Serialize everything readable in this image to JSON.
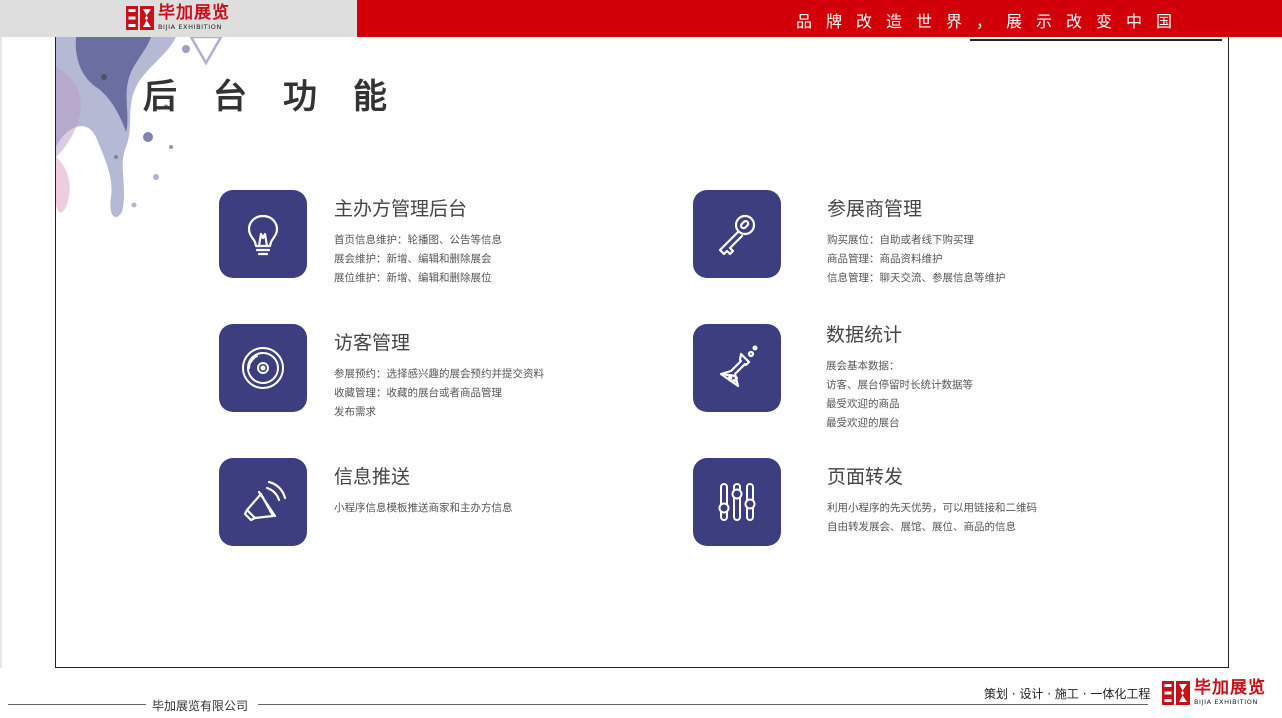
{
  "header": {
    "brand_cn": "毕加展览",
    "brand_en": "BIJIA EXHIBITION",
    "slogan": "品牌改造世界，展示改变中国",
    "colors": {
      "bar_red": "#d10009",
      "bar_gray": "#dedede",
      "logo_red": "#c8101a"
    }
  },
  "page": {
    "title": "后台功能",
    "tile_color": "#3c3e7f"
  },
  "features": [
    {
      "icon": "lightbulb-icon",
      "title": "主办方管理后台",
      "lines": [
        "首页信息维护：轮播图、公告等信息",
        "展会维护：新增、编辑和删除展会",
        "展位维护：新增、编辑和删除展位"
      ]
    },
    {
      "icon": "key-icon",
      "title": "参展商管理",
      "lines": [
        "购买展位：自助或者线下购买理",
        "商品管理：商品资料维护",
        "信息管理：聊天交流、参展信息等维护"
      ]
    },
    {
      "icon": "vinyl-disc-icon",
      "title": "访客管理",
      "lines": [
        "参展预约：选择感兴趣的展会预约并提交资料",
        "收藏管理：收藏的展台或者商品管理",
        "发布需求"
      ]
    },
    {
      "icon": "flask-icon",
      "title": "数据统计",
      "lines": [
        "展会基本数据：",
        "访客、展台停留时长统计数据等",
        "最受欢迎的商品",
        "最受欢迎的展台"
      ]
    },
    {
      "icon": "megaphone-icon",
      "title": "信息推送",
      "lines": [
        "小程序信息模板推送商家和主办方信息"
      ]
    },
    {
      "icon": "sliders-icon",
      "title": "页面转发",
      "lines": [
        "利用小程序的先天优势，可以用链接和二维码",
        "自由转发展会、展馆、展位、商品的信息"
      ]
    }
  ],
  "footer": {
    "company": "毕加展览有限公司",
    "tagline": "策划 · 设计 · 施工 · 一体化工程",
    "brand_cn": "毕加展览",
    "brand_en": "BIJIA EXHIBITION"
  }
}
